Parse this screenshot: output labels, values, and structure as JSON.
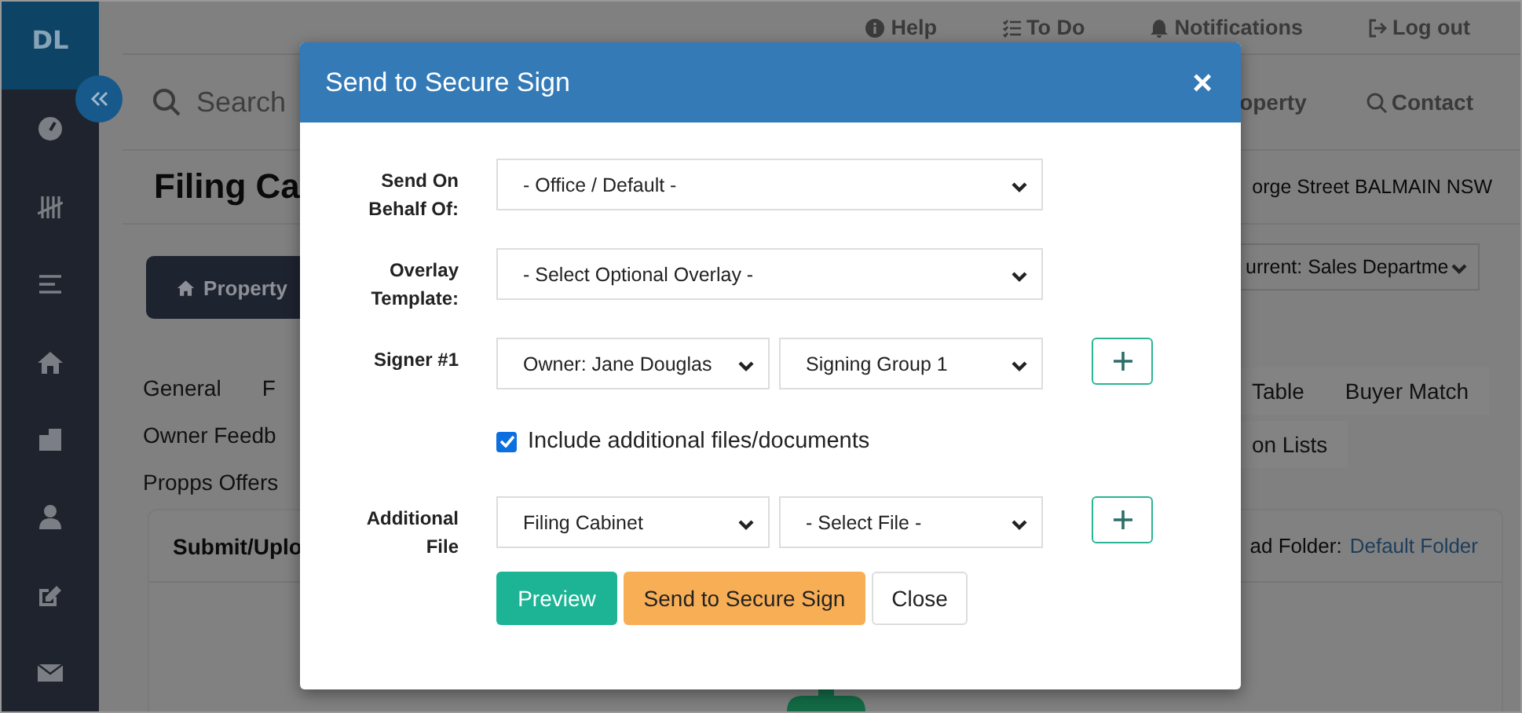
{
  "sidebar": {
    "logo": "DL"
  },
  "top_nav": [
    {
      "label": "Help"
    },
    {
      "label": "To Do"
    },
    {
      "label": "Notifications"
    },
    {
      "label": "Log out"
    }
  ],
  "search": {
    "placeholder": "Search"
  },
  "search_links": [
    {
      "label": "operty"
    },
    {
      "label": "Contact"
    }
  ],
  "page_title": "Filing Ca",
  "address": "orge Street BALMAIN NSW",
  "property_button": "Property",
  "department_select": "urrent: Sales Departme",
  "tabs_left": [
    [
      {
        "label": "General",
        "selected": false
      },
      {
        "label": "F",
        "selected": false
      }
    ],
    [
      {
        "label": "Owner Feedb",
        "selected": false
      }
    ],
    [
      {
        "label": "Propps Offers",
        "selected": false
      }
    ]
  ],
  "tabs_right": [
    [
      {
        "label": "Table",
        "selected": false
      },
      {
        "label": "Buyer Match",
        "selected": false
      }
    ],
    [
      {
        "label": "on Lists",
        "selected": false
      }
    ]
  ],
  "upload_card": {
    "title": "Submit/Uplo",
    "folder_label": "ad Folder:",
    "folder_link": "Default Folder"
  },
  "modal": {
    "title": "Send to Secure Sign",
    "close": "×",
    "fields": [
      {
        "label": "Send On Behalf Of:",
        "selects": [
          "- Office / Default -"
        ],
        "add_button": false
      },
      {
        "label": "Overlay Template:",
        "selects": [
          "- Select Optional Overlay -"
        ],
        "add_button": false
      },
      {
        "label": "Signer #1",
        "selects": [
          "Owner: Jane Douglas",
          "Signing Group 1"
        ],
        "add_button": true
      }
    ],
    "include_files": {
      "label": "Include additional files/documents",
      "checked": true
    },
    "additional": {
      "label": "Additional File",
      "selects": [
        "Filing Cabinet",
        "- Select File -"
      ],
      "add_button": true
    },
    "buttons": [
      {
        "label": "Preview",
        "kind": "primary"
      },
      {
        "label": "Send to Secure Sign",
        "kind": "warning"
      },
      {
        "label": "Close",
        "kind": "default"
      }
    ]
  }
}
